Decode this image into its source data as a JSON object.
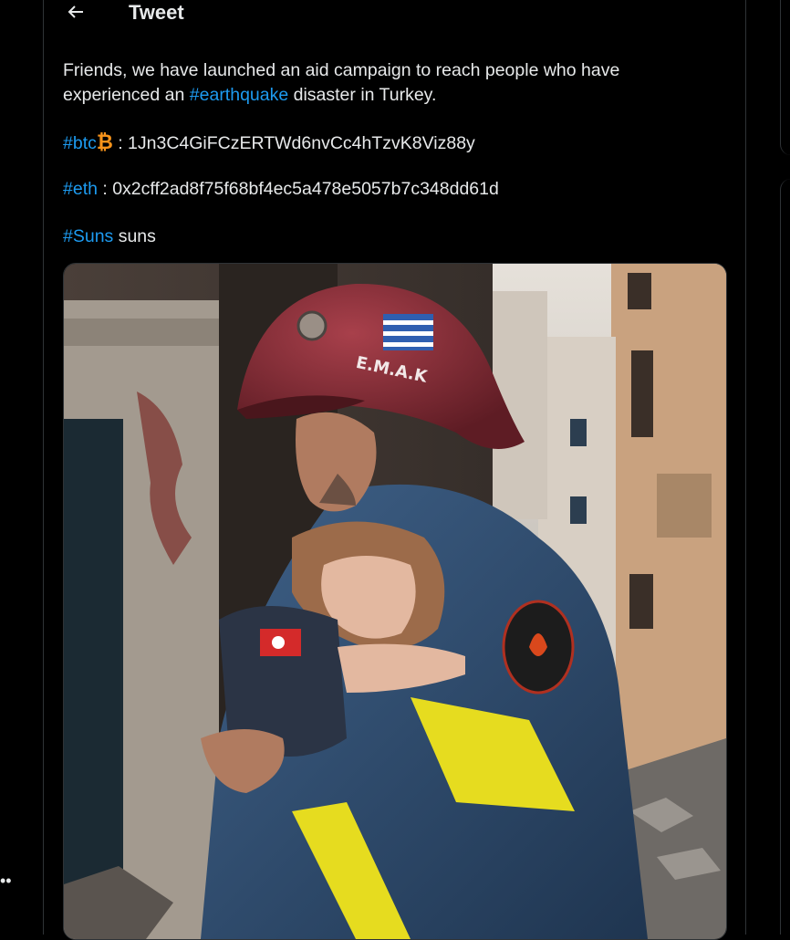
{
  "header": {
    "title": "Tweet",
    "back_icon": "arrow-left-icon"
  },
  "tweet": {
    "line1": "Friends, we have launched an aid campaign to reach people who have",
    "line2_pre": "experienced an ",
    "line2_tag": "#earthquake",
    "line2_post": " disaster in Turkey.",
    "btc_tag": "#btc",
    "btc_symbol": "₿",
    "btc_address": " : 1Jn3C4GiFCzERTWd6nvCc4hTzvK8Viz88y",
    "eth_tag": "#eth",
    "eth_address": " : 0x2cff2ad8f75f68bf4ec5a478e5057b7c348dd61d",
    "suns_tag": "#Suns",
    "suns_text": " suns"
  },
  "media": {
    "helmet_text": "E.M.A.K",
    "colors": {
      "helmet": "#8a2a35",
      "uniform": "#2e4a6a",
      "stripe": "#e6dc1f",
      "sky": "#d9d4cc"
    }
  },
  "left_edge": {
    "more_icon": "more-dots-icon",
    "text": "••"
  }
}
